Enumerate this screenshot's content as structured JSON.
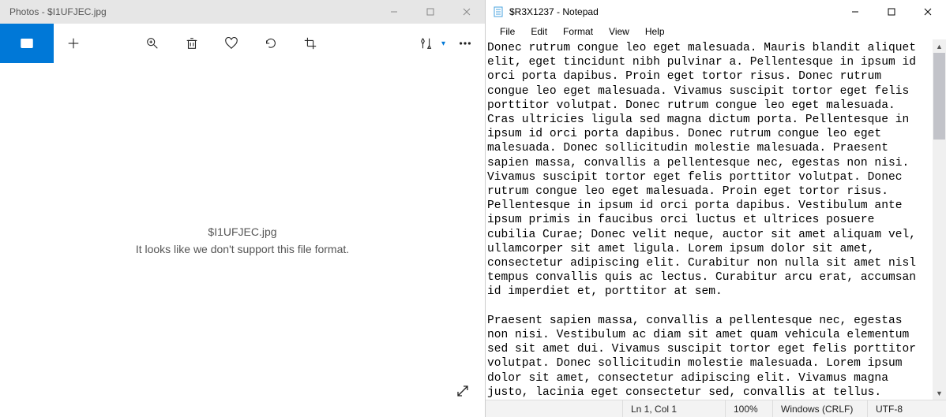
{
  "photos": {
    "titlebar": "Photos - $I1UFJEC.jpg",
    "filename": "$I1UFJEC.jpg",
    "message": "It looks like we don't support this file format."
  },
  "notepad": {
    "titlebar": "$R3X1237 - Notepad",
    "menu": {
      "file": "File",
      "edit": "Edit",
      "format": "Format",
      "view": "View",
      "help": "Help"
    },
    "content": "Donec rutrum congue leo eget malesuada. Mauris blandit aliquet elit, eget tincidunt nibh pulvinar a. Pellentesque in ipsum id orci porta dapibus. Proin eget tortor risus. Donec rutrum congue leo eget malesuada. Vivamus suscipit tortor eget felis porttitor volutpat. Donec rutrum congue leo eget malesuada. Cras ultricies ligula sed magna dictum porta. Pellentesque in ipsum id orci porta dapibus. Donec rutrum congue leo eget malesuada. Donec sollicitudin molestie malesuada. Praesent sapien massa, convallis a pellentesque nec, egestas non nisi. Vivamus suscipit tortor eget felis porttitor volutpat. Donec rutrum congue leo eget malesuada. Proin eget tortor risus. Pellentesque in ipsum id orci porta dapibus. Vestibulum ante ipsum primis in faucibus orci luctus et ultrices posuere cubilia Curae; Donec velit neque, auctor sit amet aliquam vel, ullamcorper sit amet ligula. Lorem ipsum dolor sit amet, consectetur adipiscing elit. Curabitur non nulla sit amet nisl tempus convallis quis ac lectus. Curabitur arcu erat, accumsan id imperdiet et, porttitor at sem.\n\nPraesent sapien massa, convallis a pellentesque nec, egestas non nisi. Vestibulum ac diam sit amet quam vehicula elementum sed sit amet dui. Vivamus suscipit tortor eget felis porttitor volutpat. Donec sollicitudin molestie malesuada. Lorem ipsum dolor sit amet, consectetur adipiscing elit. Vivamus magna justo, lacinia eget consectetur sed, convallis at tellus. Mauris blandit aliquet elit, eget tincidunt nibh pulvinar a. Praesent sapien massa, convallis a pellentesque nec, egestas non nisi. Curabitur arcu erat, accumsan id",
    "status": {
      "pos": "Ln 1, Col 1",
      "zoom": "100%",
      "eol": "Windows (CRLF)",
      "enc": "UTF-8"
    }
  }
}
